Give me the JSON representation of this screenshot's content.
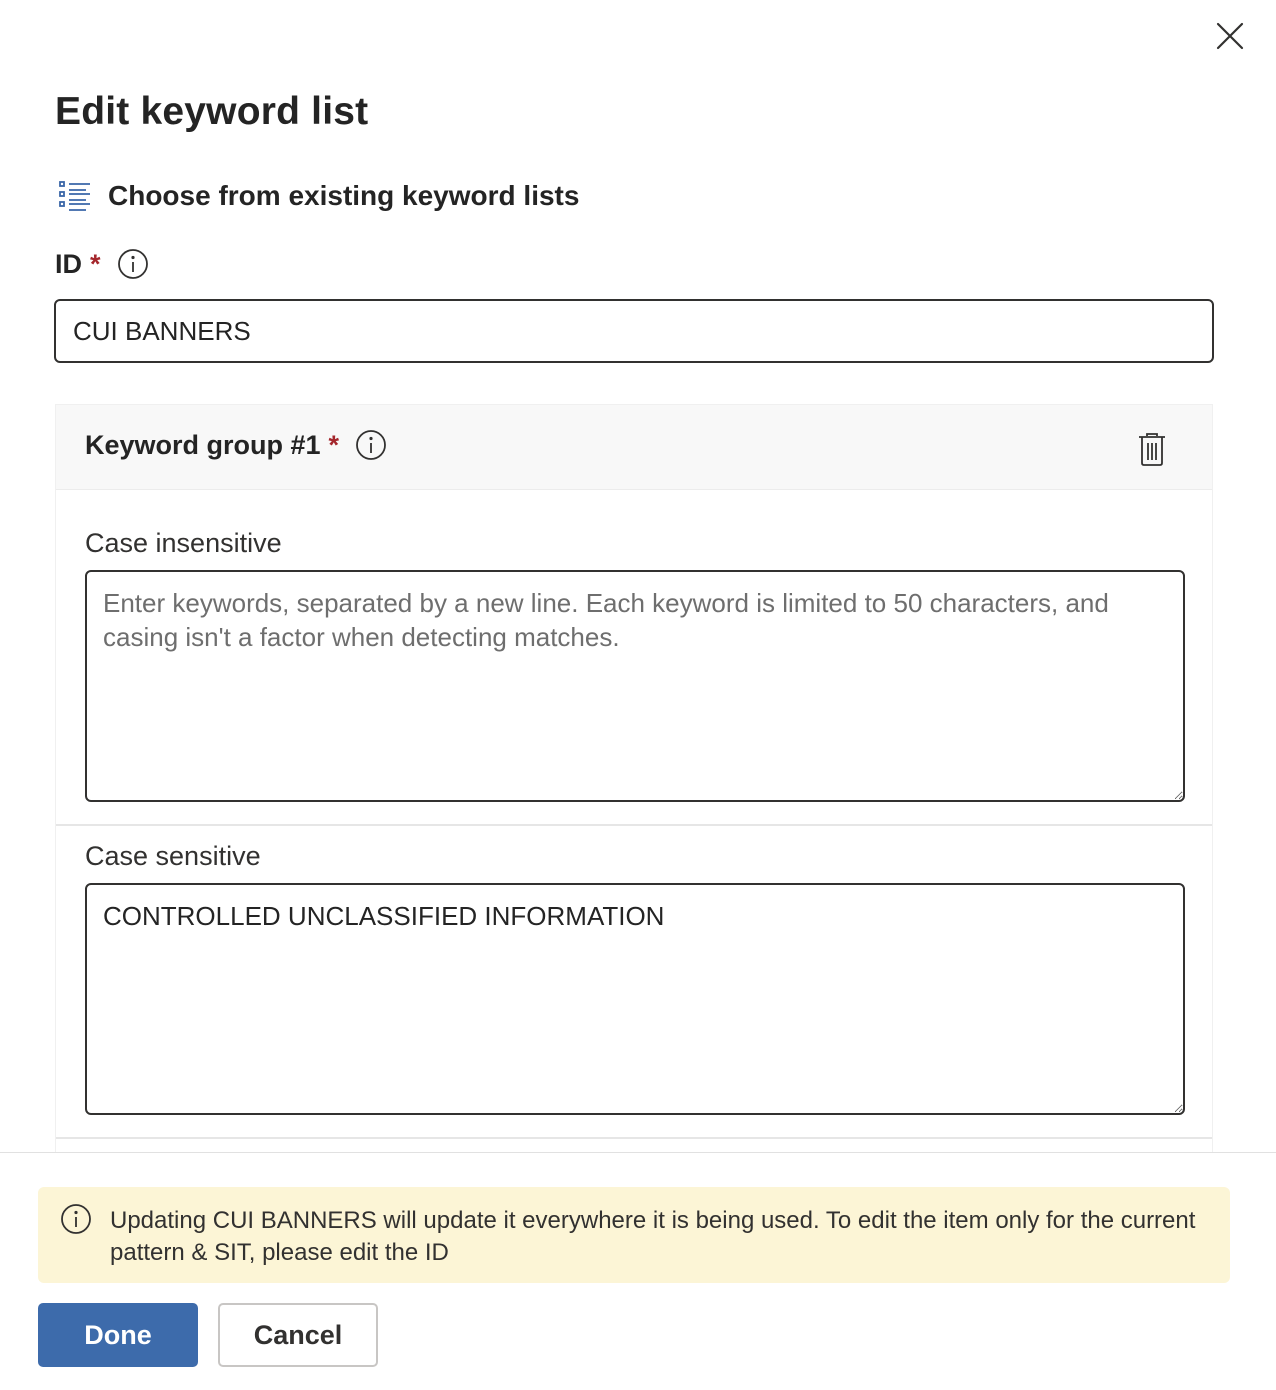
{
  "dialog": {
    "title": "Edit keyword list",
    "close_icon": "close-icon",
    "choose_link": {
      "label": "Choose from existing keyword lists",
      "icon": "bulleted-list-icon"
    }
  },
  "id_field": {
    "label": "ID",
    "required_marker": "*",
    "value": "CUI BANNERS"
  },
  "keyword_group": {
    "title": "Keyword group #1",
    "required_marker": "*",
    "case_insensitive": {
      "label": "Case insensitive",
      "placeholder": "Enter keywords, separated by a new line. Each keyword is limited to 50 characters, and casing isn't a factor when detecting matches.",
      "value": ""
    },
    "case_sensitive": {
      "label": "Case sensitive",
      "value": "CONTROLLED UNCLASSIFIED INFORMATION"
    }
  },
  "footer": {
    "notice": "Updating CUI BANNERS will update it everywhere it is being used. To edit the item only for the current pattern & SIT, please edit the ID",
    "done_label": "Done",
    "cancel_label": "Cancel"
  },
  "colors": {
    "primary": "#3d6bab",
    "required": "#a4262c",
    "notice_bg": "#fcf5d6",
    "link_icon": "#3a66a8"
  }
}
